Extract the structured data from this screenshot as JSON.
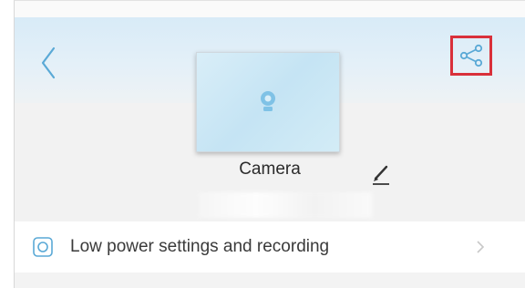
{
  "header": {
    "back_icon": "chevron-left-icon",
    "share_icon": "share-icon",
    "share_highlight_color": "#d9303a",
    "accent_color": "#5aa9d6"
  },
  "device": {
    "name": "Camera",
    "thumbnail_icon": "camera-icon",
    "edit_icon": "pencil-icon"
  },
  "settings": {
    "items": [
      {
        "label": "Low power settings and recording",
        "icon": "settings-ring-icon",
        "trailing_icon": "chevron-right-icon"
      }
    ]
  }
}
